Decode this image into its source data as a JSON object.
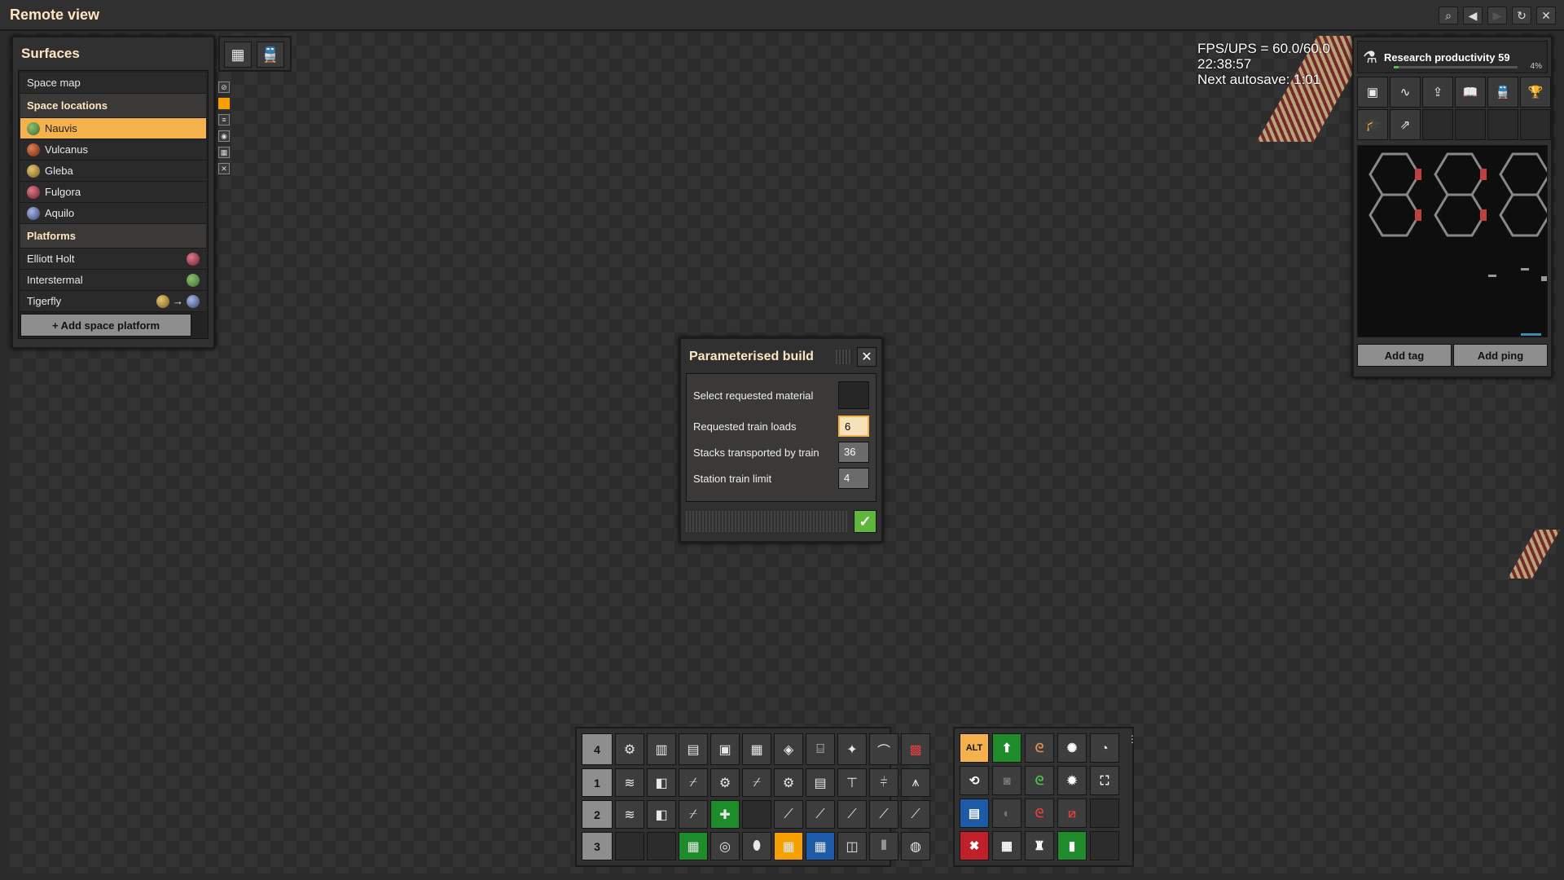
{
  "window": {
    "title": "Remote view"
  },
  "surfaces": {
    "title": "Surfaces",
    "space_map": "Space map",
    "space_locations_header": "Space locations",
    "locations": [
      {
        "name": "Nauvis",
        "color": "#5a8a3a",
        "selected": true
      },
      {
        "name": "Vulcanus",
        "color": "#b0542a",
        "selected": false
      },
      {
        "name": "Gleba",
        "color": "#b8a040",
        "selected": false
      },
      {
        "name": "Fulgora",
        "color": "#c04848",
        "selected": false
      },
      {
        "name": "Aquilo",
        "color": "#6070a8",
        "selected": false
      }
    ],
    "platforms_header": "Platforms",
    "platforms": [
      {
        "name": "Elliott Holt"
      },
      {
        "name": "Interstermal"
      },
      {
        "name": "Tigerfly",
        "arrow": "→"
      }
    ],
    "add_platform": "+ Add space platform"
  },
  "overlay": {
    "fps": "FPS/UPS = 60.0/60.0",
    "clock": "22:38:57",
    "autosave": "Next autosave: 1:01"
  },
  "research": {
    "label": "Research productivity 59",
    "percent": "4%",
    "progress": 0.04
  },
  "minimap": {
    "add_tag": "Add tag",
    "add_ping": "Add ping"
  },
  "dialog": {
    "title": "Parameterised build",
    "fields": {
      "material": "Select requested material",
      "train_loads": {
        "label": "Requested train loads",
        "value": "6"
      },
      "stacks": {
        "label": "Stacks transported by train",
        "value": "36"
      },
      "train_limit": {
        "label": "Station train limit",
        "value": "4"
      }
    }
  },
  "hotbar": {
    "rows": [
      "4",
      "1",
      "2",
      "3"
    ]
  },
  "shortcuts": {
    "alt": "ALT"
  },
  "colors": {
    "accent": "#f5b24c",
    "confirm": "#5eb63b",
    "panel": "#313031"
  }
}
